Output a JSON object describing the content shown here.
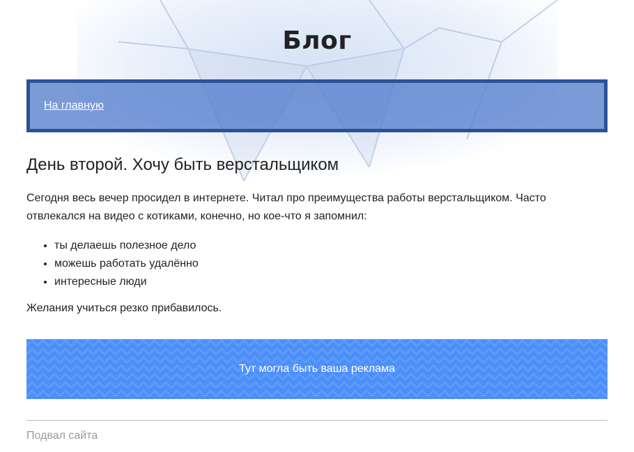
{
  "header": {
    "title": "Блог"
  },
  "nav": {
    "home_link": "На главную"
  },
  "post": {
    "title": "День второй. Хочу быть верстальщиком",
    "intro": "Сегодня весь вечер просидел в интернете. Читал про преимущества работы верстальщиком. Часто отвлекался на видео с котиками, конечно, но кое-что я запомнил:",
    "items": [
      "ты делаешь полезное дело",
      "можешь работать удалённо",
      "интересные люди"
    ],
    "conclusion": "Желания учиться резко прибавилось."
  },
  "ad": {
    "text": "Тут могла быть ваша реклама"
  },
  "footer": {
    "text": "Подвал сайта"
  },
  "colors": {
    "nav_border": "#2c5196",
    "nav_background": "#547dcd",
    "ad_background": "#4d8ff8",
    "footer_text": "#999999"
  }
}
